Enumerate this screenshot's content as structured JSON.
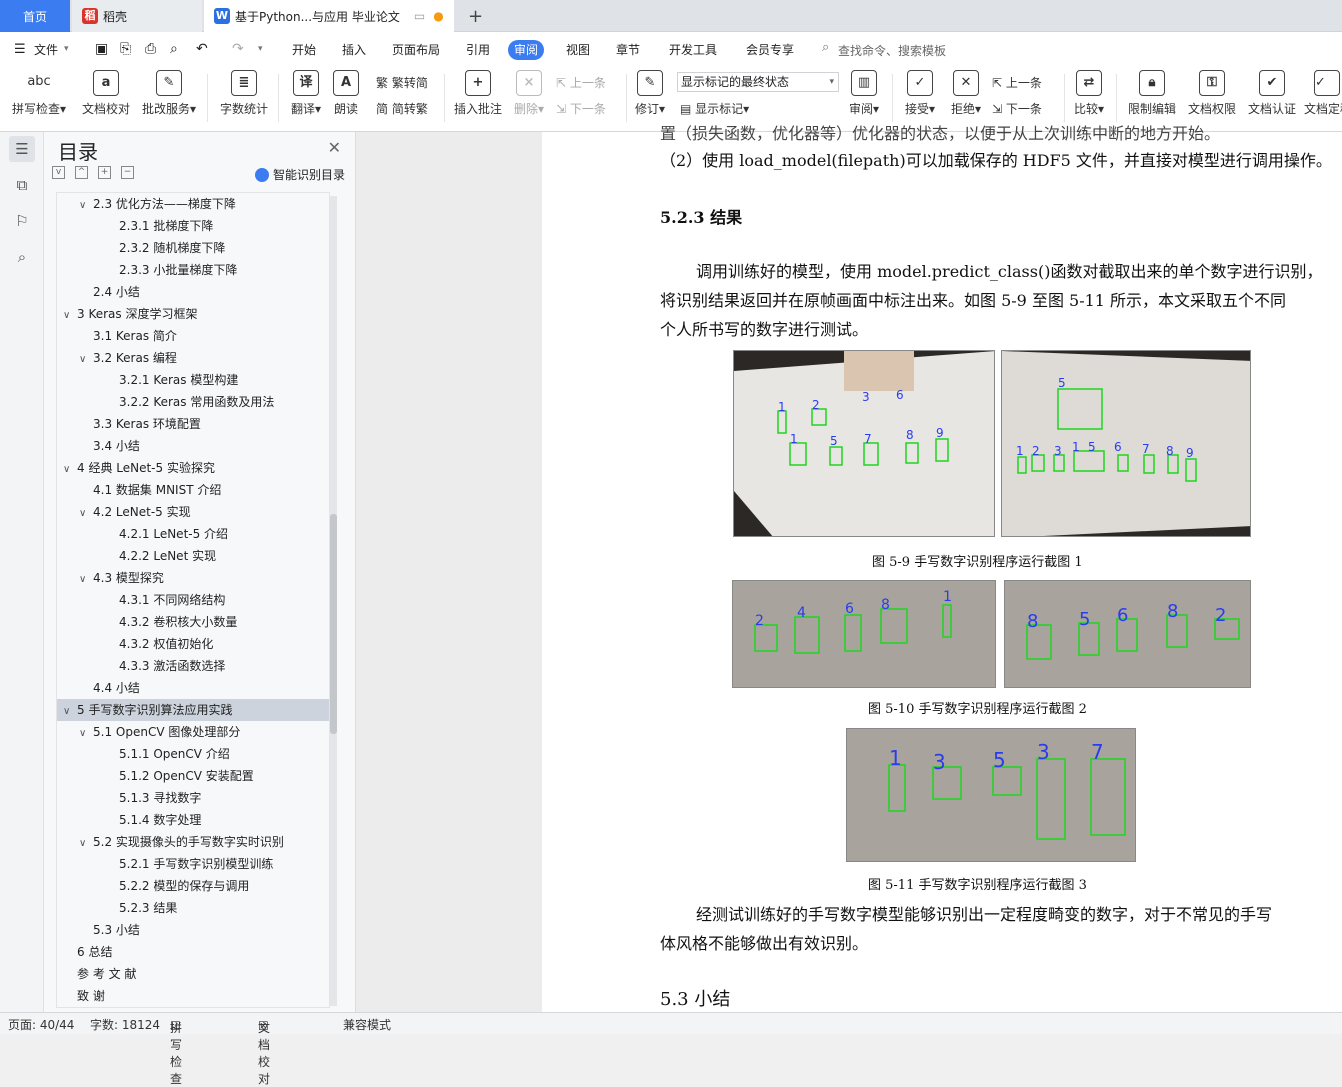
{
  "tabs": {
    "home": "首页",
    "daoke": "稻壳",
    "doc": "基于Python...与应用 毕业论文"
  },
  "quick": {
    "file": "文件"
  },
  "menus": [
    "开始",
    "插入",
    "页面布局",
    "引用",
    "审阅",
    "视图",
    "章节",
    "开发工具",
    "会员专享"
  ],
  "search_placeholder": "查找命令、搜索模板",
  "ribbon": {
    "spell": "拼写检查",
    "doccheck": "文档校对",
    "batch": "批改服务",
    "wordcount": "字数统计",
    "translate": "翻译",
    "read": "朗读",
    "trad": "繁转简",
    "simp": "简转繁",
    "insert_comment": "插入批注",
    "delete": "删除",
    "prev_comment": "上一条",
    "next_comment": "下一条",
    "revise": "修订",
    "markup_state": "显示标记的最终状态",
    "show_markup": "显示标记",
    "review": "审阅",
    "accept": "接受",
    "reject": "拒绝",
    "prev": "上一条",
    "next": "下一条",
    "compare": "比较",
    "restrict": "限制编辑",
    "perm": "文档权限",
    "auth": "文档认证",
    "final": "文档定稿"
  },
  "toc": {
    "title": "目录",
    "smart": "智能识别目录",
    "items": [
      {
        "text": "2.3  优化方法——梯度下降",
        "level": 2,
        "caret": "v"
      },
      {
        "text": "2.3.1  批梯度下降",
        "level": 3
      },
      {
        "text": "2.3.2  随机梯度下降",
        "level": 3
      },
      {
        "text": "2.3.3  小批量梯度下降",
        "level": 3
      },
      {
        "text": "2.4  小结",
        "level": 2
      },
      {
        "text": "3 Keras 深度学习框架",
        "level": 1,
        "caret": "v"
      },
      {
        "text": "3.1 Keras 简介",
        "level": 2
      },
      {
        "text": "3.2 Keras 编程",
        "level": 2,
        "caret": "v"
      },
      {
        "text": "3.2.1 Keras 模型构建",
        "level": 3
      },
      {
        "text": "3.2.2 Keras 常用函数及用法",
        "level": 3
      },
      {
        "text": "3.3 Keras 环境配置",
        "level": 2
      },
      {
        "text": "3.4  小结",
        "level": 2
      },
      {
        "text": "4  经典 LeNet-5 实验探究",
        "level": 1,
        "caret": "v"
      },
      {
        "text": "4.1  数据集 MNIST 介绍",
        "level": 2
      },
      {
        "text": "4.2 LeNet-5 实现",
        "level": 2,
        "caret": "v"
      },
      {
        "text": "4.2.1 LeNet-5 介绍",
        "level": 3
      },
      {
        "text": "4.2.2 LeNet 实现",
        "level": 3
      },
      {
        "text": "4.3  模型探究",
        "level": 2,
        "caret": "v"
      },
      {
        "text": "4.3.1  不同网络结构",
        "level": 3
      },
      {
        "text": "4.3.2  卷积核大小数量",
        "level": 3
      },
      {
        "text": "4.3.2  权值初始化",
        "level": 3
      },
      {
        "text": "4.3.3  激活函数选择",
        "level": 3
      },
      {
        "text": "4.4  小结",
        "level": 2
      },
      {
        "text": "5  手写数字识别算法应用实践",
        "level": 1,
        "caret": "v",
        "selected": true
      },
      {
        "text": "5.1 OpenCV 图像处理部分",
        "level": 2,
        "caret": "v"
      },
      {
        "text": "5.1.1 OpenCV 介绍",
        "level": 3
      },
      {
        "text": "5.1.2 OpenCV 安装配置",
        "level": 3
      },
      {
        "text": "5.1.3  寻找数字",
        "level": 3
      },
      {
        "text": "5.1.4  数字处理",
        "level": 3
      },
      {
        "text": "5.2  实现摄像头的手写数字实时识别",
        "level": 2,
        "caret": "v"
      },
      {
        "text": "5.2.1  手写数字识别模型训练",
        "level": 3
      },
      {
        "text": "5.2.2  模型的保存与调用",
        "level": 3
      },
      {
        "text": "5.2.3  结果",
        "level": 3
      },
      {
        "text": "5.3 小结",
        "level": 2
      },
      {
        "text": "6  总结",
        "level": 1
      },
      {
        "text": "参 考 文 献",
        "level": 1
      },
      {
        "text": "致 谢",
        "level": 1
      }
    ]
  },
  "doc": {
    "cut_line": "置（损失函数，优化器等）优化器的状态，以便于从上次训练中断的地方开始。",
    "p2": "（2）使用 load_model(filepath)可以加载保存的 HDF5 文件，并直接对模型进行调用操作。",
    "h523": "5.2.3  结果",
    "p3a": "调用训练好的模型，使用 model.predict_class()函数对截取出来的单个数字进行识别，",
    "p3b": "将识别结果返回并在原帧画面中标注出来。如图 5-9 至图 5-11 所示，本文采取五个不同",
    "p3c": "个人所书写的数字进行测试。",
    "cap1": "图 5-9  手写数字识别程序运行截图 1",
    "cap2": "图 5-10  手写数字识别程序运行截图 2",
    "cap3": "图 5-11  手写数字识别程序运行截图 3",
    "p4a": "经测试训练好的手写数字模型能够识别出一定程度畸变的数字，对于不常见的手写",
    "p4b": "体风格不能够做出有效识别。",
    "h53": "5.3 小结"
  },
  "status": {
    "page": "页面: 40/44",
    "words": "字数: 18124",
    "spell": "拼写检查",
    "check": "文档校对",
    "compat": "兼容模式"
  }
}
